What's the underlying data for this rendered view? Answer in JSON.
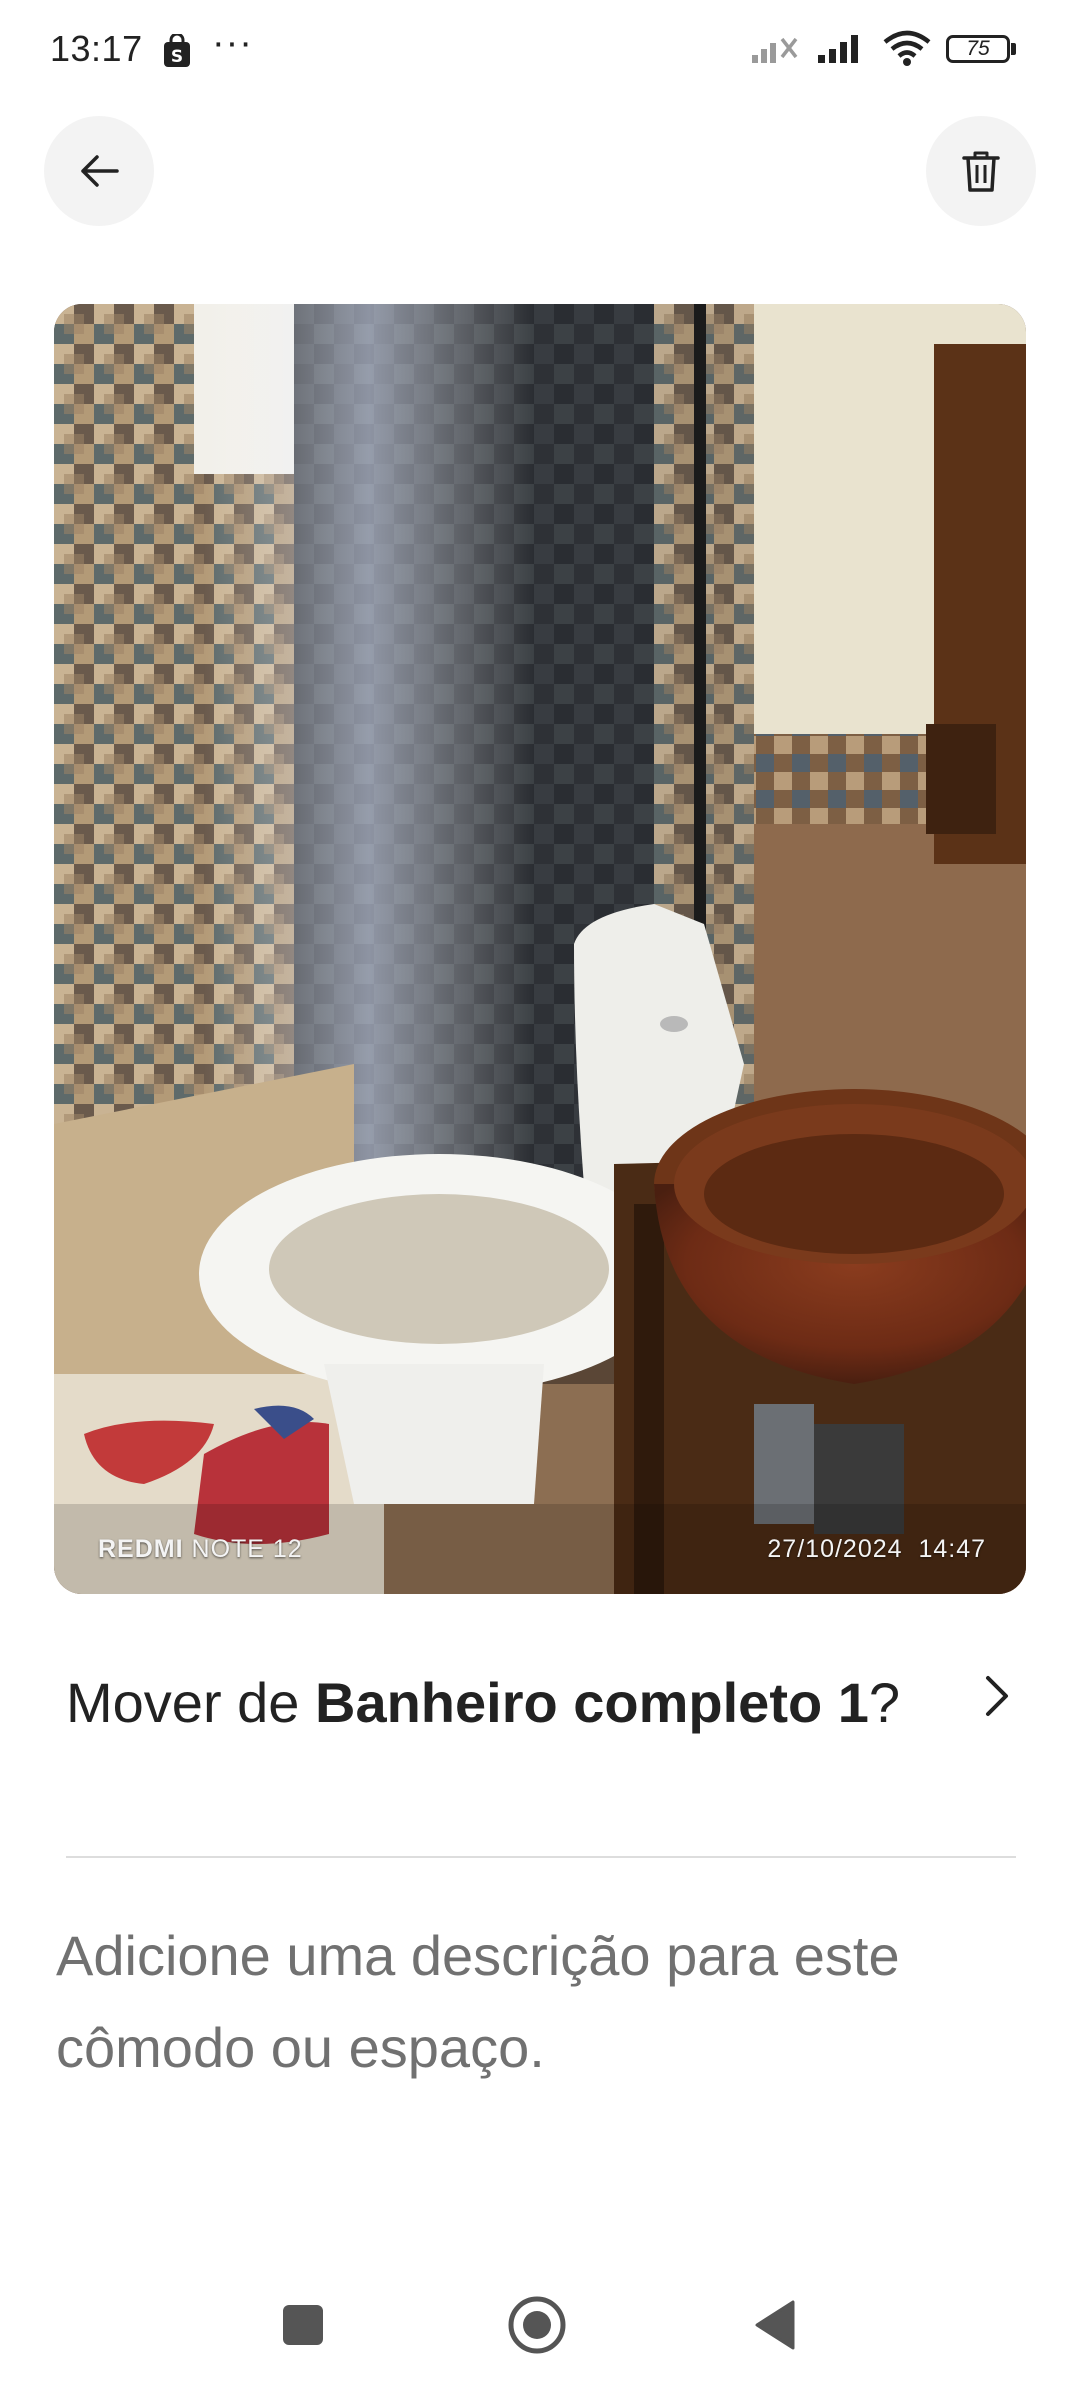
{
  "status_bar": {
    "time": "13:17",
    "more": "···",
    "battery_level": "75"
  },
  "header": {
    "back_icon": "arrow-left-icon",
    "delete_icon": "trash-icon"
  },
  "photo": {
    "device_brand": "REDMI",
    "device_model": "NOTE 12",
    "date": "27/10/2024",
    "time": "14:47"
  },
  "move": {
    "prefix": "Mover de ",
    "room": "Banheiro completo 1",
    "suffix": "?"
  },
  "description": {
    "placeholder": "Adicione uma descrição para este cômodo ou espaço."
  },
  "nav": {
    "recents_icon": "square-icon",
    "home_icon": "circle-icon",
    "back_icon": "triangle-back-icon"
  },
  "colors": {
    "text_primary": "#222222",
    "text_secondary": "#717171",
    "button_bg": "#f3f3f3",
    "divider": "#dddddd"
  }
}
